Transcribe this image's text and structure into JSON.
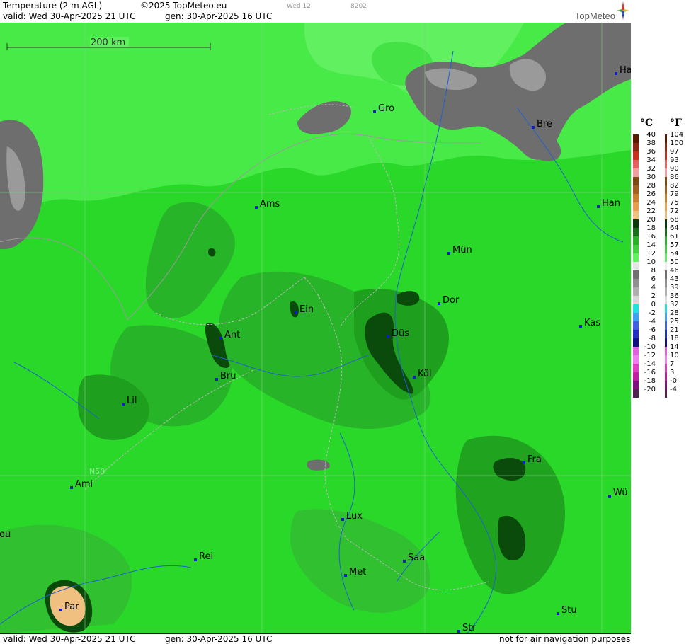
{
  "header": {
    "title": "Temperature (2 m AGL)",
    "copyright": "©2025 TopMeteo.eu",
    "ghost1": "Wed 12",
    "ghost2": "8202",
    "valid": "valid:  Wed  30-Apr-2025  21 UTC",
    "gen": "gen: 30-Apr-2025 16 UTC",
    "brand": "TopMeteo"
  },
  "footer": {
    "valid": "valid:  Wed  30-Apr-2025  21 UTC",
    "gen": "gen: 30-Apr-2025 16 UTC",
    "note": "not for air navigation purposes"
  },
  "map": {
    "scale_label": "200 km",
    "lat_label": "N50",
    "cities": [
      {
        "name": "Gro"
      },
      {
        "name": "Bre"
      },
      {
        "name": "Ha"
      },
      {
        "name": "Ams"
      },
      {
        "name": "Han"
      },
      {
        "name": "Mün"
      },
      {
        "name": "Dor"
      },
      {
        "name": "Ein"
      },
      {
        "name": "Ant"
      },
      {
        "name": "Düs"
      },
      {
        "name": "Kas"
      },
      {
        "name": "Bru"
      },
      {
        "name": "Köl"
      },
      {
        "name": "Lil"
      },
      {
        "name": "Fra"
      },
      {
        "name": "Ami"
      },
      {
        "name": "Wü"
      },
      {
        "name": "Lux"
      },
      {
        "name": "ou"
      },
      {
        "name": "Rei"
      },
      {
        "name": "Saa"
      },
      {
        "name": "Met"
      },
      {
        "name": "Par"
      },
      {
        "name": "Stu"
      },
      {
        "name": "Str"
      }
    ]
  },
  "legend": {
    "celsius_header": "°C",
    "fahrenheit_header": "°F",
    "celsius": [
      "40",
      "38",
      "36",
      "34",
      "32",
      "30",
      "28",
      "26",
      "24",
      "22",
      "20",
      "18",
      "16",
      "14",
      "12",
      "10",
      "8",
      "6",
      "4",
      "2",
      "0",
      "-2",
      "-4",
      "-6",
      "-8",
      "-10",
      "-12",
      "-14",
      "-16",
      "-18",
      "-20"
    ],
    "fahrenheit": [
      "104",
      "100",
      "97",
      "93",
      "90",
      "86",
      "82",
      "79",
      "75",
      "72",
      "68",
      "64",
      "61",
      "57",
      "54",
      "50",
      "46",
      "43",
      "39",
      "36",
      "32",
      "28",
      "25",
      "21",
      "18",
      "14",
      "10",
      "7",
      "3",
      "-0",
      "-4"
    ],
    "colors": [
      "#5a1a00",
      "#8a2a10",
      "#c83020",
      "#e86060",
      "#f0a0a0",
      "#7a4a10",
      "#a06020",
      "#c88030",
      "#e8a050",
      "#f0c080",
      "#0a3a0a",
      "#1a701a",
      "#2ab02a",
      "#40d040",
      "#60f060",
      "#e8e8e8",
      "#707070",
      "#909090",
      "#b0b0b0",
      "#d8d8d8",
      "#20e0e0",
      "#40a0f0",
      "#4060e0",
      "#2030c0",
      "#101080",
      "#e060e0",
      "#f080f0",
      "#e040c0",
      "#c020a0",
      "#801080",
      "#502050"
    ]
  }
}
